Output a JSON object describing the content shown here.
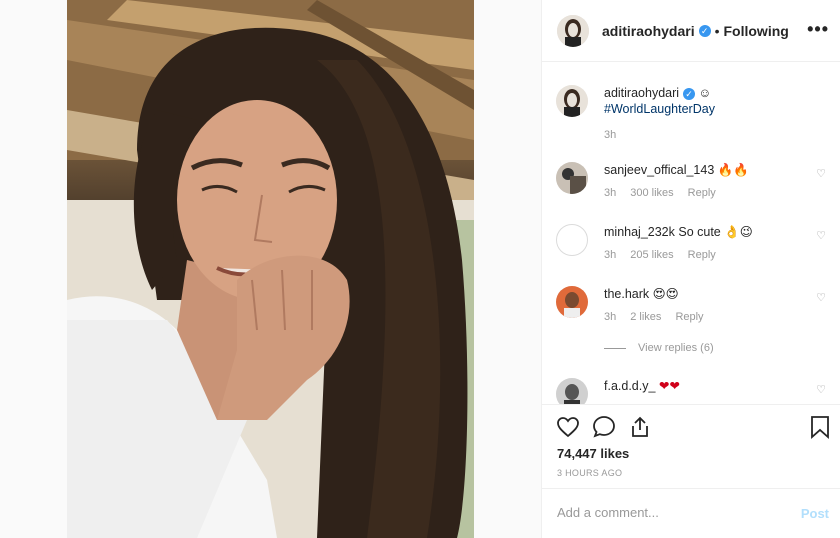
{
  "post": {
    "username": "aditiraohydari",
    "verified_mark": "✓",
    "separator": "•",
    "follow_state": "Following",
    "more_label": "•••",
    "image_alt": "selfie-photo"
  },
  "caption": {
    "username": "aditiraohydari",
    "emoji": "☺",
    "hashtag": "#WorldLaughterDay",
    "time": "3h"
  },
  "comments": [
    {
      "username": "sanjeev_offical_143",
      "text": "🔥🔥",
      "time": "3h",
      "likes": "300 likes",
      "reply": "Reply"
    },
    {
      "username": "minhaj_232k",
      "text": "So cute 👌😉",
      "time": "3h",
      "likes": "205 likes",
      "reply": "Reply"
    },
    {
      "username": "the.hark",
      "text": "😍😍",
      "time": "3h",
      "likes": "2 likes",
      "reply": "Reply",
      "view_replies": "View replies (6)"
    },
    {
      "username": "f.a.d.d.y_",
      "text": "❤❤"
    }
  ],
  "actions": {
    "likes_count": "74,447 likes",
    "time_ago": "3 HOURS AGO"
  },
  "comment_box": {
    "placeholder": "Add a comment...",
    "post_label": "Post"
  },
  "colors": {
    "accent": "#3897f0",
    "hashtag": "#003569",
    "muted": "#999999",
    "post_disabled": "#b2dffc"
  }
}
